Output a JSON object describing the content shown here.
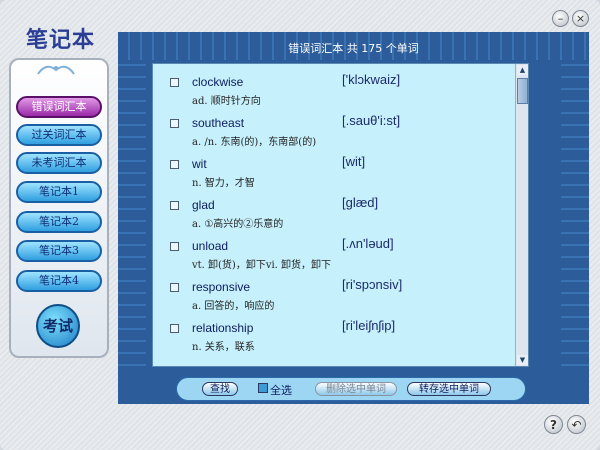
{
  "app": {
    "title": "笔记本"
  },
  "window_controls": {
    "minimize": "–",
    "close": "×",
    "help": "?",
    "back": "↶"
  },
  "nav": {
    "items": [
      {
        "label": "错误词汇本",
        "active": true
      },
      {
        "label": "过关词汇本",
        "active": false
      },
      {
        "label": "未考词汇本",
        "active": false
      },
      {
        "label": "笔记本1",
        "active": false
      },
      {
        "label": "笔记本2",
        "active": false
      },
      {
        "label": "笔记本3",
        "active": false
      },
      {
        "label": "笔记本4",
        "active": false
      }
    ],
    "exam_label": "考试"
  },
  "header": {
    "text": "错误词汇本    共 175 个单词"
  },
  "words": [
    {
      "word": "clockwise",
      "phonetic": "['klɔkwaiz]",
      "definition": "ad. 顺时针方向"
    },
    {
      "word": "southeast",
      "phonetic": "[.sauθ'i:st]",
      "definition": "a. /n. 东南(的)，东南部(的)"
    },
    {
      "word": "wit",
      "phonetic": "[wit]",
      "definition": "n. 智力，才智"
    },
    {
      "word": "glad",
      "phonetic": "[glæd]",
      "definition": "a. ①高兴的②乐意的"
    },
    {
      "word": "unload",
      "phonetic": "[.ʌn'ləud]",
      "definition": "vt. 卸(货)，卸下vi. 卸货，卸下"
    },
    {
      "word": "responsive",
      "phonetic": "[ri'spɔnsiv]",
      "definition": "a. 回答的，响应的"
    },
    {
      "word": "relationship",
      "phonetic": "[ri'leiʃnʃip]",
      "definition": "n. 关系，联系"
    }
  ],
  "scroll": {
    "up": "▲",
    "down": "▼"
  },
  "toolbar": {
    "find": "查找",
    "select_all": "全选",
    "delete_selected": "删除选中单词",
    "save_selected": "转存选中单词"
  },
  "colors": {
    "accent": "#2c5d9a",
    "list_bg": "#c6f0fb",
    "active_nav": "#9a2aa8"
  }
}
